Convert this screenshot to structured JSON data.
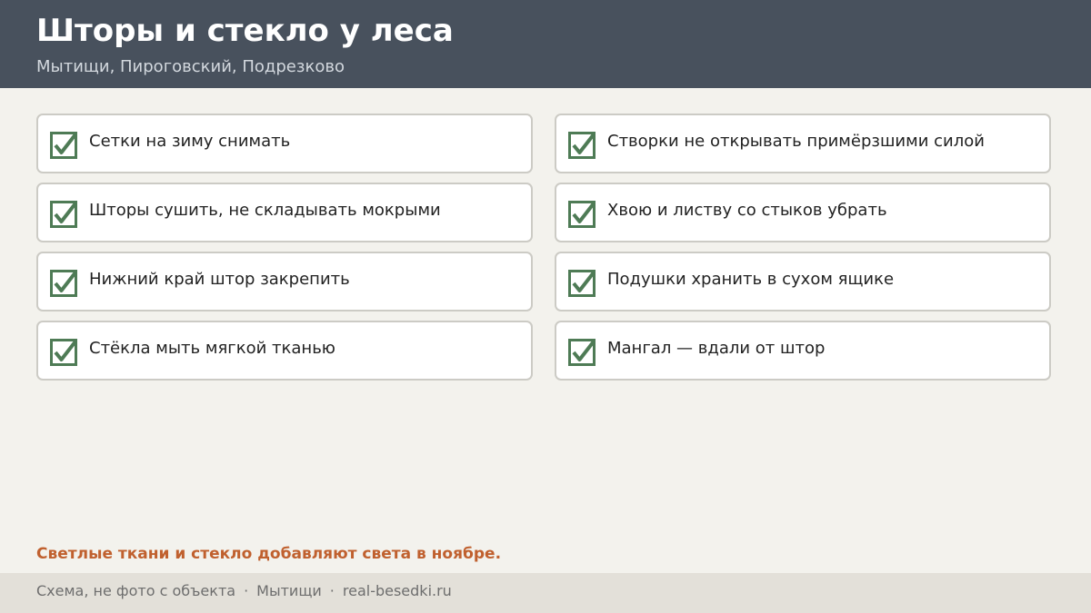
{
  "header": {
    "title": "Шторы и стекло у леса",
    "subtitle": "Мытищи, Пироговский, Подрезково"
  },
  "checklist": {
    "icon": "checkbox-checked-icon",
    "check_color": "#4e7b55",
    "items": [
      {
        "label": "Сетки на зиму снимать",
        "checked": true
      },
      {
        "label": "Створки не открывать примёрзшими силой",
        "checked": true
      },
      {
        "label": "Шторы сушить, не складывать мокрыми",
        "checked": true
      },
      {
        "label": "Хвою и листву со стыков убрать",
        "checked": true
      },
      {
        "label": "Нижний край штор закрепить",
        "checked": true
      },
      {
        "label": "Подушки хранить в сухом ящике",
        "checked": true
      },
      {
        "label": "Стёкла мыть мягкой тканью",
        "checked": true
      },
      {
        "label": "Мангал — вдали от штор",
        "checked": true
      }
    ]
  },
  "note": "Светлые ткани и стекло добавляют света в ноябре.",
  "footer": {
    "parts": [
      "Схема, не фото с объекта",
      "Мытищи",
      "real-besedki.ru"
    ],
    "separator": "·"
  },
  "colors": {
    "header_bg": "#48515d",
    "page_bg": "#f3f2ed",
    "accent": "#c0602e",
    "check": "#4e7b55"
  }
}
